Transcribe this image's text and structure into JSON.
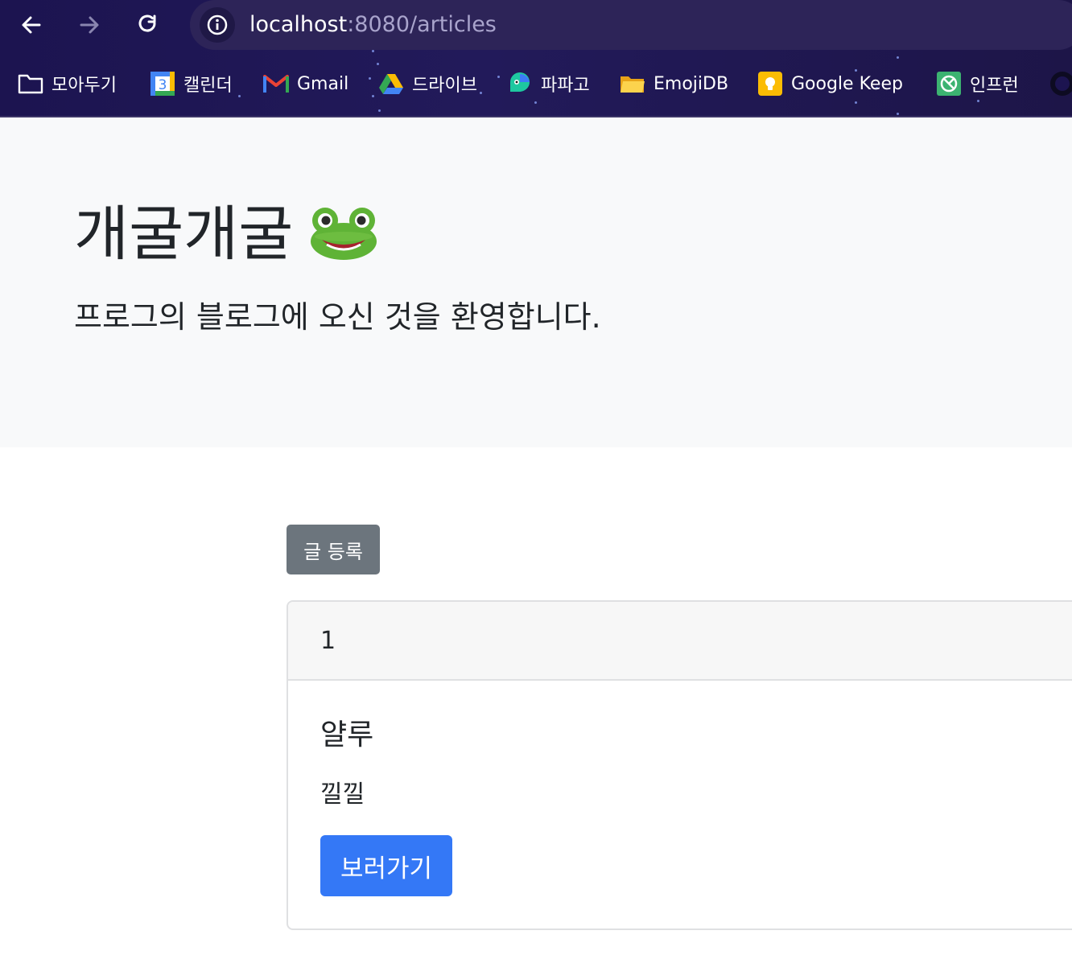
{
  "browser": {
    "url_host": "localhost",
    "url_rest": ":8080/articles",
    "bookmarks": [
      {
        "label": "모아두기",
        "icon": "folder-icon"
      },
      {
        "label": "캘린더",
        "icon": "google-calendar-icon"
      },
      {
        "label": "Gmail",
        "icon": "gmail-icon"
      },
      {
        "label": "드라이브",
        "icon": "google-drive-icon"
      },
      {
        "label": "파파고",
        "icon": "papago-icon"
      },
      {
        "label": "EmojiDB",
        "icon": "folder-yellow-icon"
      },
      {
        "label": "Google Keep",
        "icon": "google-keep-icon"
      },
      {
        "label": "인프런",
        "icon": "inflearn-icon"
      }
    ],
    "calendar_day": "3"
  },
  "hero": {
    "title": "개굴개굴",
    "subtitle": "프로그의 블로그에 오신 것을 환영합니다."
  },
  "actions": {
    "new_post_label": "글 등록"
  },
  "article": {
    "id": "1",
    "title": "얄루",
    "content": "낄낄",
    "view_label": "보러가기"
  },
  "colors": {
    "primary": "#3478f6",
    "secondary": "#6c757d",
    "chrome_bg": "#1c1450"
  }
}
